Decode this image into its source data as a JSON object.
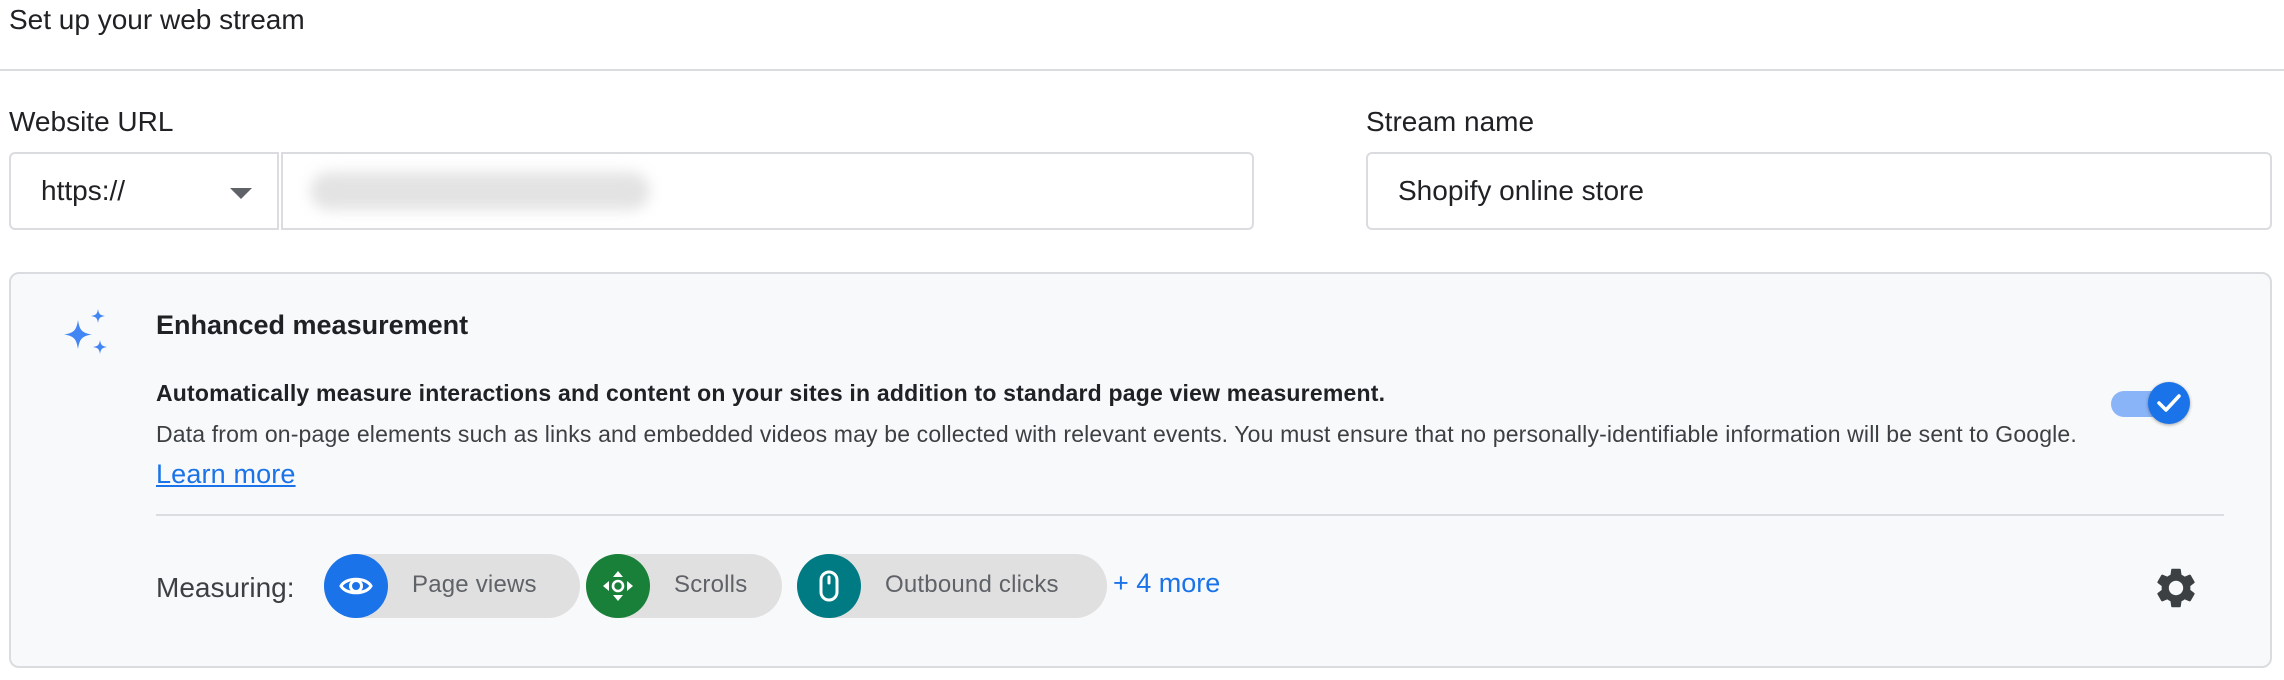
{
  "header": {
    "title": "Set up your web stream"
  },
  "website_url": {
    "label": "Website URL",
    "protocol": "https://",
    "value": ""
  },
  "stream_name": {
    "label": "Stream name",
    "value": "Shopify online store"
  },
  "enhanced_measurement": {
    "icon": "sparkle-icon",
    "title": "Enhanced measurement",
    "description_bold": "Automatically measure interactions and content on your sites in addition to standard page view measurement.",
    "description": "Data from on-page elements such as links and embedded videos may be collected with relevant events. You must ensure that no personally-identifiable information will be sent to Google.",
    "learn_more": "Learn more",
    "enabled": true,
    "measuring_label": "Measuring:",
    "chips": [
      {
        "label": "Page views",
        "icon": "eye-icon",
        "color": "#1a73e8"
      },
      {
        "label": "Scrolls",
        "icon": "scroll-arrows-icon",
        "color": "#188038"
      },
      {
        "label": "Outbound clicks",
        "icon": "mouse-icon",
        "color": "#007b83"
      }
    ],
    "more": "+ 4 more",
    "settings_icon": "gear-icon"
  },
  "colors": {
    "accent": "#1a73e8",
    "chip_background": "#e0e0e0",
    "card_background": "#f8f9fa"
  }
}
